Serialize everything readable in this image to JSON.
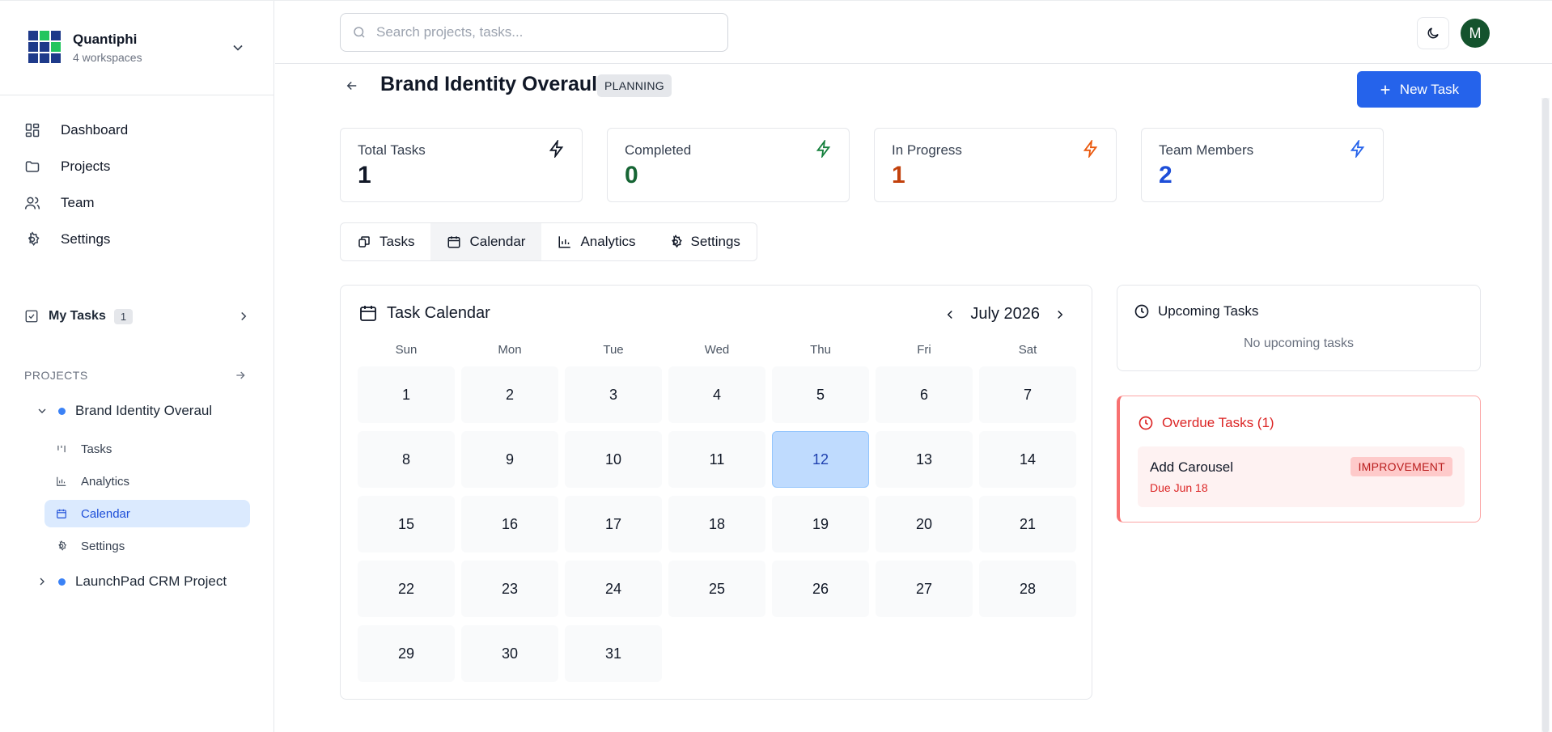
{
  "workspace": {
    "name": "Quantiphi",
    "subtitle": "4 workspaces"
  },
  "sidebar": {
    "nav": [
      {
        "label": "Dashboard",
        "icon": "dashboard-icon"
      },
      {
        "label": "Projects",
        "icon": "folder-icon"
      },
      {
        "label": "Team",
        "icon": "users-icon"
      },
      {
        "label": "Settings",
        "icon": "gear-icon"
      }
    ],
    "my_tasks": {
      "label": "My Tasks",
      "count": "1"
    },
    "projects_heading": "PROJECTS",
    "projects": [
      {
        "name": "Brand Identity Overaul",
        "expanded": true,
        "children": [
          {
            "label": "Tasks",
            "icon": "kanban-icon"
          },
          {
            "label": "Analytics",
            "icon": "bar-chart-icon"
          },
          {
            "label": "Calendar",
            "icon": "calendar-icon",
            "active": true
          },
          {
            "label": "Settings",
            "icon": "gear-icon"
          }
        ]
      },
      {
        "name": "LaunchPad CRM Project",
        "expanded": false
      }
    ]
  },
  "topbar": {
    "search_placeholder": "Search projects, tasks...",
    "avatar_initial": "M"
  },
  "project": {
    "title": "Brand Identity Overaul",
    "status": "PLANNING",
    "new_task_label": "New Task"
  },
  "stats": [
    {
      "label": "Total Tasks",
      "value": "1",
      "color": "#111827",
      "icon_color": "#111827"
    },
    {
      "label": "Completed",
      "value": "0",
      "color": "#166534",
      "icon_color": "#15803d"
    },
    {
      "label": "In Progress",
      "value": "1",
      "color": "#c2410c",
      "icon_color": "#ea580c"
    },
    {
      "label": "Team Members",
      "value": "2",
      "color": "#1d4ed8",
      "icon_color": "#2563eb"
    }
  ],
  "tabs": [
    {
      "label": "Tasks",
      "icon": "kanban-icon"
    },
    {
      "label": "Calendar",
      "icon": "calendar-icon",
      "active": true
    },
    {
      "label": "Analytics",
      "icon": "bar-chart-icon"
    },
    {
      "label": "Settings",
      "icon": "gear-icon"
    }
  ],
  "calendar": {
    "title": "Task Calendar",
    "month": "July 2026",
    "weekdays": [
      "Sun",
      "Mon",
      "Tue",
      "Wed",
      "Thu",
      "Fri",
      "Sat"
    ],
    "days": [
      "1",
      "2",
      "3",
      "4",
      "5",
      "6",
      "7",
      "8",
      "9",
      "10",
      "11",
      "12",
      "13",
      "14",
      "15",
      "16",
      "17",
      "18",
      "19",
      "20",
      "21",
      "22",
      "23",
      "24",
      "25",
      "26",
      "27",
      "28",
      "29",
      "30",
      "31"
    ],
    "today": "12"
  },
  "upcoming": {
    "title": "Upcoming Tasks",
    "empty_text": "No upcoming tasks"
  },
  "overdue": {
    "title": "Overdue Tasks (1)",
    "tasks": [
      {
        "title": "Add Carousel",
        "due": "Due Jun 18",
        "tag": "IMPROVEMENT"
      }
    ]
  },
  "colors": {
    "accent": "#2563eb",
    "overdue": "#dc2626",
    "avatar": "#14532d"
  }
}
